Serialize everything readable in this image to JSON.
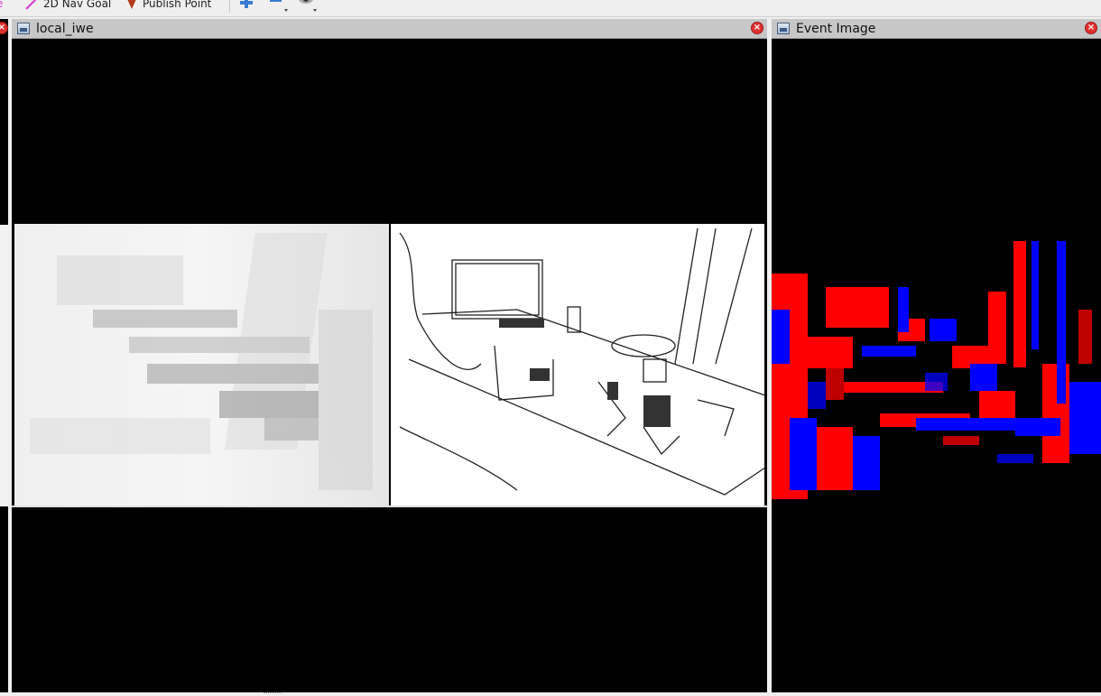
{
  "toolbar": {
    "nav_goal_label": "2D Nav Goal",
    "publish_point_label": "Publish Point",
    "nav_goal_color": "#d43bd4",
    "publish_point_color": "#b13b1b",
    "plus_icon": "plus-icon",
    "minus_icon": "minus-icon",
    "eye_icon": "eye-icon"
  },
  "panels": {
    "local_iwe": {
      "title": "local_iwe"
    },
    "event_image": {
      "title": "Event Image"
    }
  },
  "colors": {
    "event_positive": "#ff0000",
    "event_negative": "#0000ff",
    "background": "#000000"
  }
}
